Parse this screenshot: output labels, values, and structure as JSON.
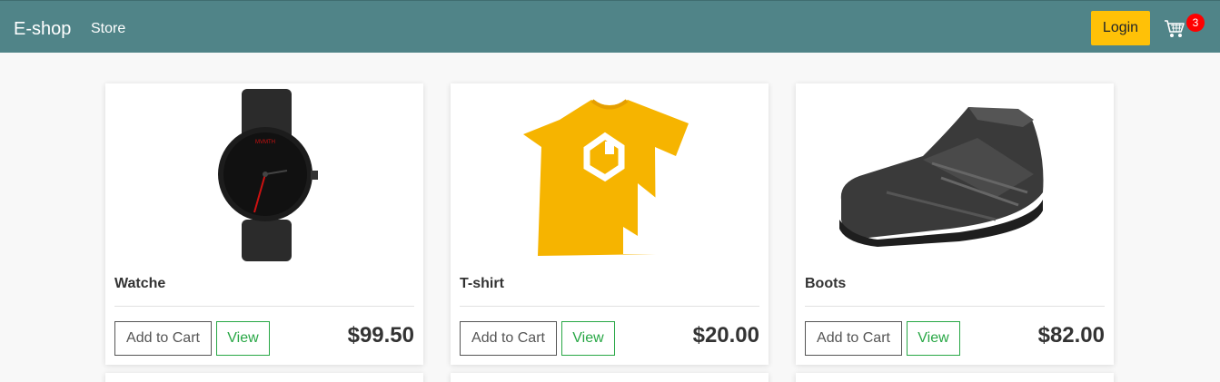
{
  "nav": {
    "brand": "E-shop",
    "store_link": "Store",
    "login_label": "Login",
    "cart_count": "3"
  },
  "products": [
    {
      "name": "Watche",
      "price": "$99.50",
      "add_label": "Add to Cart",
      "view_label": "View",
      "image": "watch-image"
    },
    {
      "name": "T-shirt",
      "price": "$20.00",
      "add_label": "Add to Cart",
      "view_label": "View",
      "image": "tshirt-image"
    },
    {
      "name": "Boots",
      "price": "$82.00",
      "add_label": "Add to Cart",
      "view_label": "View",
      "image": "shoe-image"
    }
  ],
  "colors": {
    "navbar": "#508488",
    "login_button": "#ffc107",
    "view_button": "#28a745",
    "badge": "#ff0000"
  }
}
